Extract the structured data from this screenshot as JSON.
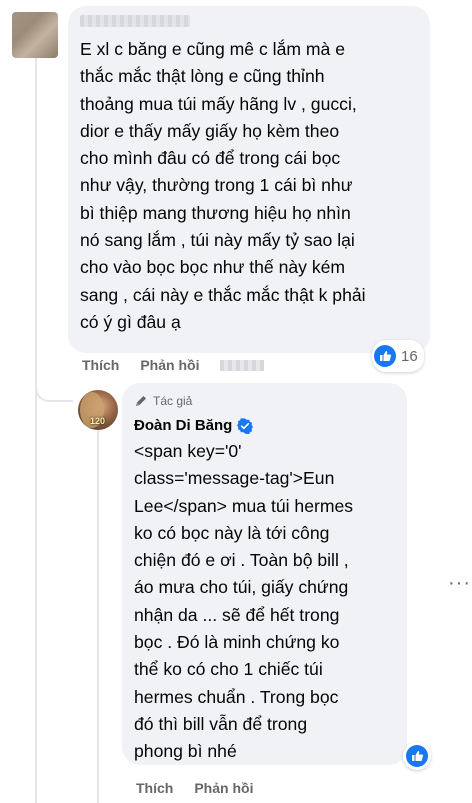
{
  "comment": {
    "text": "E xl c băng e cũng mê c lắm mà e\nthắc mắc thật lòng e cũng thỉnh\nthoảng mua túi mấy hãng lv , gucci,\ndior e thấy mấy giấy họ kèm theo\ncho mình đâu có để trong cái bọc\nnhư vậy, thường trong 1 cái bì như\nbì thiệp mang thương hiệu họ nhìn\nnó sang lắm , túi này mấy tỷ sao lại\ncho vào bọc bọc như thế này kém\nsang , cái này e thắc mắc thật k phải\ncó ý gì đâu ạ",
    "reaction_count": "16",
    "actions": {
      "like": "Thích",
      "reply": "Phản hồi"
    }
  },
  "reply": {
    "author_tag": "Tác giả",
    "author_name": "Đoàn Di Băng",
    "avatar_badge": "120",
    "text": "<span key='0'\nclass='message-tag'>Eun\nLee</span> mua túi hermes\nko có bọc này là tới công\nchiện đó e ơi . Toàn bộ bill ,\náo mưa cho túi, giấy chứng\nnhận da ... sẽ để hết trong\nbọc . Đó là minh chứng ko\nthể ko có cho 1 chiếc túi\nhermes chuẩn . Trong bọc\nđó thì bill vẫn để trong\nphong bì nhé",
    "actions": {
      "like": "Thích",
      "reply": "Phản hồi"
    }
  },
  "more_menu": "···",
  "colors": {
    "bubble": "#f0f2f5",
    "secondary_text": "#65676b",
    "like_blue": "#1877f2"
  }
}
